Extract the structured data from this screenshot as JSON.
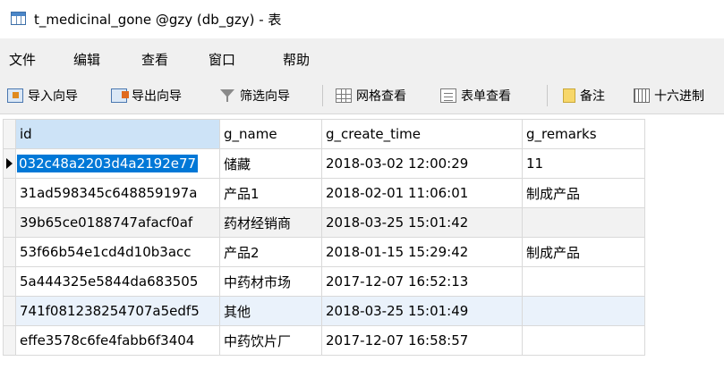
{
  "window": {
    "title": "t_medicinal_gone @gzy (db_gzy) - 表",
    "icon": "table-icon"
  },
  "menu": {
    "items": [
      "文件",
      "编辑",
      "查看",
      "窗口",
      "帮助"
    ]
  },
  "toolbar": {
    "import_label": "导入向导",
    "export_label": "导出向导",
    "filter_label": "筛选向导",
    "grid_view_label": "网格查看",
    "form_view_label": "表单查看",
    "memo_label": "备注",
    "hex_label": "十六进制"
  },
  "grid": {
    "columns": [
      "id",
      "g_name",
      "g_create_time",
      "g_remarks"
    ],
    "rows": [
      [
        "032c48a2203d4a2192e77",
        "储藏",
        "2018-03-02 12:00:29",
        "11"
      ],
      [
        "31ad598345c648859197a",
        "产品1",
        "2018-02-01 11:06:01",
        "制成产品"
      ],
      [
        "39b65ce0188747afacf0af",
        "药材经销商",
        "2018-03-25 15:01:42",
        ""
      ],
      [
        "53f66b54e1cd4d10b3acc",
        "产品2",
        "2018-01-15 15:29:42",
        "制成产品"
      ],
      [
        "5a444325e5844da683505",
        "中药材市场",
        "2017-12-07 16:52:13",
        ""
      ],
      [
        "741f081238254707a5edf5",
        "其他",
        "2018-03-25 15:01:49",
        ""
      ],
      [
        "effe3578c6fe4fabb6f3404",
        "中药饮片厂",
        "2017-12-07 16:58:57",
        ""
      ]
    ],
    "selected_row": 0,
    "selected_color": "#0078d7"
  }
}
